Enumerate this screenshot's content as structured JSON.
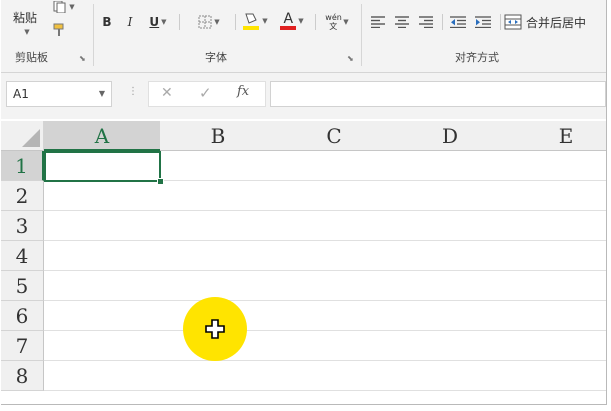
{
  "ribbon": {
    "clipboard": {
      "paste_label": "粘贴",
      "group_label": "剪贴板"
    },
    "font": {
      "bold": "B",
      "italic": "I",
      "underline": "U",
      "font_color_glyph": "A",
      "phonetic_glyph": "wén 文",
      "group_label": "字体"
    },
    "alignment": {
      "merge_center_label": "合并后居中",
      "group_label": "对齐方式"
    }
  },
  "formula_bar": {
    "name_box": "A1",
    "fx_label": "fx"
  },
  "sheet": {
    "columns": [
      "A",
      "B",
      "C",
      "D",
      "E"
    ],
    "rows": [
      "1",
      "2",
      "3",
      "4",
      "5",
      "6",
      "7",
      "8"
    ],
    "selected_cell": "A1"
  },
  "colors": {
    "accent": "#217346",
    "highlight": "#ffe400",
    "font_color_bar": "#e02020",
    "fill_color_bar": "#ffe400"
  }
}
